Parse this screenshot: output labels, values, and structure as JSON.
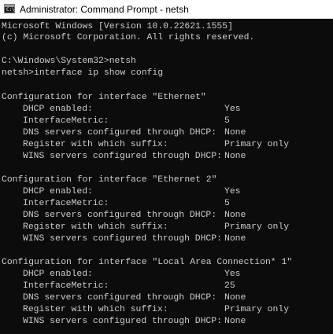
{
  "window": {
    "title": "Administrator: Command Prompt - netsh"
  },
  "console": {
    "header": [
      "Microsoft Windows [Version 10.0.22621.1555]",
      "(c) Microsoft Corporation. All rights reserved."
    ],
    "commands": [
      "C:\\Windows\\System32>netsh",
      "netsh>interface ip show config"
    ],
    "interfaces": [
      {
        "heading": "Configuration for interface \"Ethernet\"",
        "fields": [
          {
            "key": "DHCP enabled:",
            "value": "Yes"
          },
          {
            "key": "InterfaceMetric:",
            "value": "5"
          },
          {
            "key": "DNS servers configured through DHCP:",
            "value": "None"
          },
          {
            "key": "Register with which suffix:",
            "value": "Primary only"
          },
          {
            "key": "WINS servers configured through DHCP:",
            "value": "None"
          }
        ]
      },
      {
        "heading": "Configuration for interface \"Ethernet 2\"",
        "fields": [
          {
            "key": "DHCP enabled:",
            "value": "Yes"
          },
          {
            "key": "InterfaceMetric:",
            "value": "5"
          },
          {
            "key": "DNS servers configured through DHCP:",
            "value": "None"
          },
          {
            "key": "Register with which suffix:",
            "value": "Primary only"
          },
          {
            "key": "WINS servers configured through DHCP:",
            "value": "None"
          }
        ]
      },
      {
        "heading": "Configuration for interface \"Local Area Connection* 1\"",
        "fields": [
          {
            "key": "DHCP enabled:",
            "value": "Yes"
          },
          {
            "key": "InterfaceMetric:",
            "value": "25"
          },
          {
            "key": "DNS servers configured through DHCP:",
            "value": "None"
          },
          {
            "key": "Register with which suffix:",
            "value": "Primary only"
          },
          {
            "key": "WINS servers configured through DHCP:",
            "value": "None"
          }
        ]
      }
    ]
  }
}
